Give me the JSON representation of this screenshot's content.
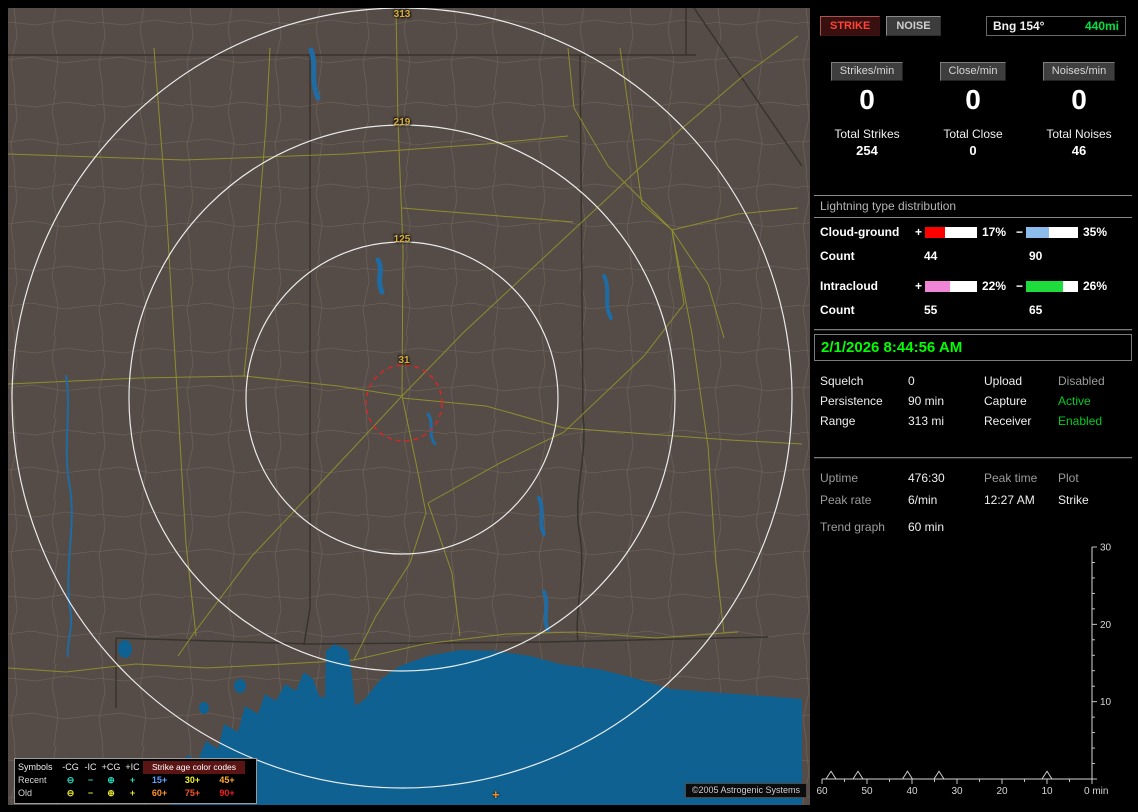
{
  "map": {
    "ring_labels": [
      "313",
      "219",
      "125",
      "31"
    ],
    "strike_symbol": "+",
    "copyright": "©2005 Astrogenic Systems",
    "legend": {
      "symbols_header": "Symbols",
      "symbol_cols": [
        "-CG",
        "-IC",
        "+CG",
        "+IC"
      ],
      "age_header": "Strike age color codes",
      "recent_label": "Recent",
      "recent_symbols": [
        "⊖",
        "−",
        "⊕",
        "+"
      ],
      "recent_ages": [
        "15+",
        "30+",
        "45+"
      ],
      "old_label": "Old",
      "old_symbols": [
        "⊖",
        "−",
        "⊕",
        "+"
      ],
      "old_ages": [
        "60+",
        "75+",
        "90+"
      ]
    }
  },
  "sidebar": {
    "strike_button": "STRIKE",
    "noise_button": "NOISE",
    "bearing_label": "Bng 154°",
    "bearing_range": "440mi",
    "rates": [
      {
        "label": "Strikes/min",
        "value": "0",
        "total_label": "Total Strikes",
        "total_value": "254"
      },
      {
        "label": "Close/min",
        "value": "0",
        "total_label": "Total Close",
        "total_value": "0"
      },
      {
        "label": "Noises/min",
        "value": "0",
        "total_label": "Total Noises",
        "total_value": "46"
      }
    ],
    "distribution_title": "Lightning type distribution",
    "distribution": [
      {
        "label": "Cloud-ground",
        "plus_sign": "+",
        "plus_pct": "17%",
        "minus_sign": "−",
        "minus_pct": "35%",
        "count_label": "Count",
        "plus_count": "44",
        "minus_count": "90"
      },
      {
        "label": "Intracloud",
        "plus_sign": "+",
        "plus_pct": "22%",
        "minus_sign": "−",
        "minus_pct": "26%",
        "count_label": "Count",
        "plus_count": "55",
        "minus_count": "65"
      }
    ],
    "bar_fills": {
      "cg_plus": 38,
      "cg_minus": 44,
      "ic_plus": 48,
      "ic_minus": 72
    },
    "clock": "2/1/2026 8:44:56 AM",
    "status_rows": [
      {
        "label1": "Squelch",
        "value1": "0",
        "label2": "Upload",
        "value2": "Disabled"
      },
      {
        "label1": "Persistence",
        "value1": "90 min",
        "label2": "Capture",
        "value2": "Active"
      },
      {
        "label1": "Range",
        "value1": "313 mi",
        "label2": "Receiver",
        "value2": "Enabled"
      }
    ],
    "info": {
      "uptime_label": "Uptime",
      "uptime_value": "476:30",
      "peak_time_label": "Peak time",
      "plot_label": "Plot",
      "peak_rate_label": "Peak rate",
      "peak_rate_value": "6/min",
      "peak_time_value": "12:27 AM",
      "plot_value": "Strike",
      "trend_label": "Trend graph",
      "trend_value": "60 min"
    },
    "colors": {
      "clock_green": "#00ff00",
      "status_active_green": "#00cc22",
      "status_disabled_gray": "#9c9c9c",
      "range_green": "#00e040",
      "strike_red": "#ff4438",
      "cg_plus_bar": "#ff0000",
      "cg_minus_bar": "#8cbcec",
      "ic_plus_bar": "#ee85d5",
      "ic_minus_bar": "#1edc3c"
    }
  },
  "trend_chart": {
    "type": "line",
    "y_ticks": [
      "30",
      "20",
      "10"
    ],
    "y_max": 30,
    "x_ticks": [
      "60",
      "50",
      "40",
      "30",
      "20",
      "10"
    ],
    "x_end_label": "0 min",
    "x_span_min": 60,
    "spikes": [
      {
        "min": 58,
        "rate": 1
      },
      {
        "min": 52,
        "rate": 1
      },
      {
        "min": 41,
        "rate": 1
      },
      {
        "min": 34,
        "rate": 1
      },
      {
        "min": 10,
        "rate": 1
      }
    ]
  }
}
